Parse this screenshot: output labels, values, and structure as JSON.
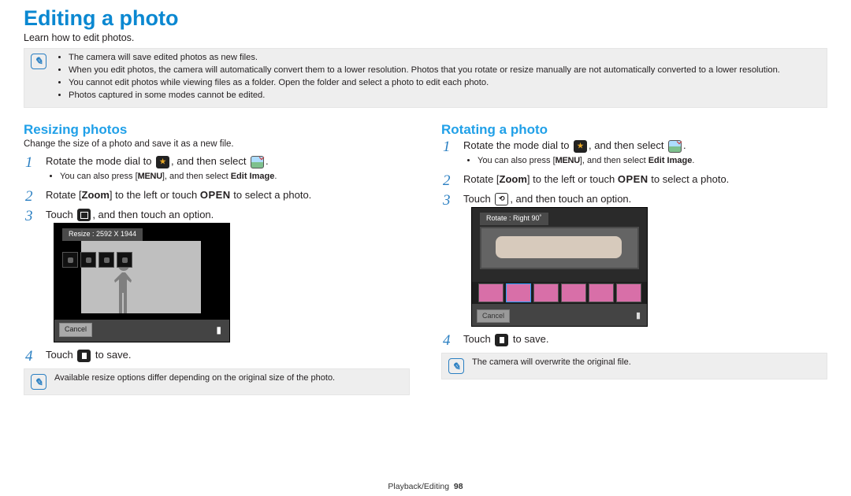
{
  "page": {
    "title": "Editing a photo",
    "lead": "Learn how to edit photos.",
    "notes": [
      "The camera will save edited photos as new files.",
      "When you edit photos, the camera will automatically convert them to a lower resolution. Photos that you rotate or resize manually are not automatically converted to a lower resolution.",
      "You cannot edit photos while viewing files as a folder. Open the folder and select a photo to edit each photo.",
      "Photos captured in some modes cannot be edited."
    ]
  },
  "resizing": {
    "title": "Resizing photos",
    "sub": "Change the size of a photo and save it as a new file.",
    "step1_a": "Rotate the mode dial to ",
    "step1_b": ", and then select ",
    "step1_c": ".",
    "step1_note_a": "You can also press [",
    "step1_note_menu": "MENU",
    "step1_note_b": "], and then select ",
    "step1_note_bold": "Edit Image",
    "step1_note_c": ".",
    "step2_a": "Rotate [",
    "step2_bold": "Zoom",
    "step2_b": "] to the left or touch ",
    "step2_small": "OPEN",
    "step2_c": " to select a photo.",
    "step3_a": "Touch ",
    "step3_b": ", and then touch an option.",
    "step4_a": "Touch ",
    "step4_b": " to save.",
    "screen_label": "Resize : 2592 X 1944",
    "screen_cancel": "Cancel",
    "note_after": "Available resize options differ depending on the original size of the photo."
  },
  "rotating": {
    "title": "Rotating a photo",
    "step1_a": "Rotate the mode dial to ",
    "step1_b": ", and then select ",
    "step1_c": ".",
    "step1_note_a": "You can also press [",
    "step1_note_menu": "MENU",
    "step1_note_b": "], and then select ",
    "step1_note_bold": "Edit Image",
    "step1_note_c": ".",
    "step2_a": "Rotate [",
    "step2_bold": "Zoom",
    "step2_b": "] to the left or touch ",
    "step2_small": "OPEN",
    "step2_c": " to select a photo.",
    "step3_a": "Touch ",
    "step3_b": ", and then touch an option.",
    "step4_a": "Touch ",
    "step4_b": " to save.",
    "screen_label": "Rotate : Right 90˚",
    "screen_cancel": "Cancel",
    "note_after": "The camera will overwrite the original file."
  },
  "footer": {
    "section": "Playback/Editing",
    "page": "98"
  }
}
